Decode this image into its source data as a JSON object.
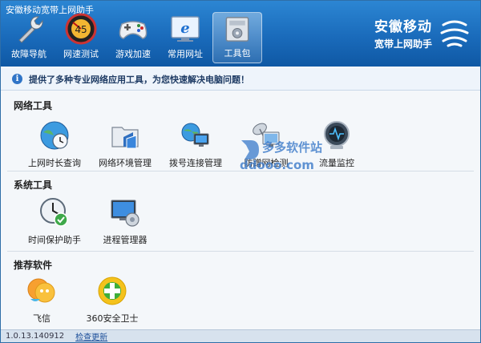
{
  "window": {
    "title": "安徽移动宽带上网助手"
  },
  "toolbar": [
    {
      "label": "故障导航",
      "icon": "wrench-icon"
    },
    {
      "label": "网速测试",
      "icon": "speedometer-icon"
    },
    {
      "label": "游戏加速",
      "icon": "gamepad-icon"
    },
    {
      "label": "常用网址",
      "icon": "ie-browser-icon"
    },
    {
      "label": "工具包",
      "icon": "toolbox-icon",
      "active": true
    }
  ],
  "brand": {
    "line1": "安徽移动",
    "line2": "宽带上网助手"
  },
  "info": {
    "message": "提供了多种专业网络应用工具，为您快速解决电脑问题！"
  },
  "sections": [
    {
      "title": "网络工具",
      "items": [
        {
          "label": "上网时长查询",
          "icon": "globe-clock-icon"
        },
        {
          "label": "网络环境管理",
          "icon": "folder-network-icon"
        },
        {
          "label": "拨号连接管理",
          "icon": "dialup-connection-icon"
        },
        {
          "label": "防蹭网检测",
          "icon": "satellite-monitor-icon"
        },
        {
          "label": "流量监控",
          "icon": "traffic-monitor-icon"
        }
      ]
    },
    {
      "title": "系统工具",
      "items": [
        {
          "label": "时间保护助手",
          "icon": "clock-shield-icon"
        },
        {
          "label": "进程管理器",
          "icon": "process-manager-icon"
        }
      ]
    },
    {
      "title": "推荐软件",
      "items": [
        {
          "label": "飞信",
          "icon": "fetion-icon"
        },
        {
          "label": "360安全卫士",
          "icon": "360-safeguard-icon"
        }
      ]
    }
  ],
  "footer": {
    "version": "1.0.13.140912",
    "update_link": "检查更新"
  },
  "watermark": {
    "line1": "多多软件站",
    "line2": "ddooo.com"
  },
  "colors": {
    "header": "#1a6bbb",
    "accent": "#2f74c7"
  }
}
